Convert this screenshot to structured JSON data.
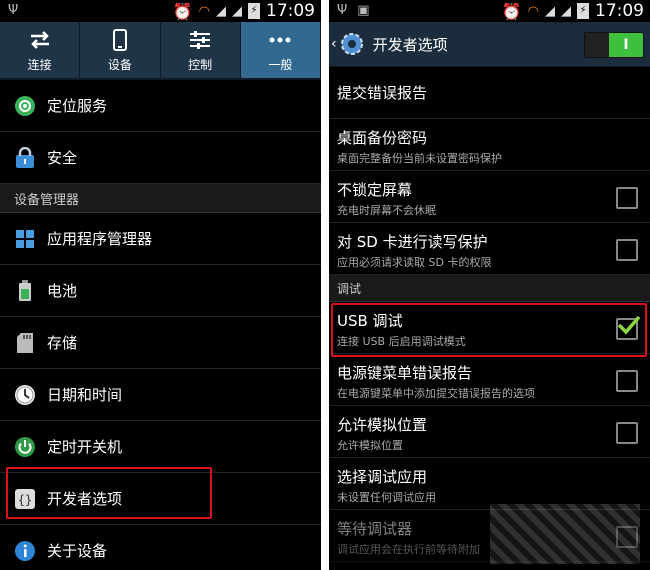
{
  "left": {
    "status": {
      "time": "17:09"
    },
    "tabs": [
      {
        "label": "连接",
        "icon": "swap-arrows-icon"
      },
      {
        "label": "设备",
        "icon": "phone-icon"
      },
      {
        "label": "控制",
        "icon": "sliders-icon"
      },
      {
        "label": "一般",
        "icon": "more-dots-icon",
        "active": true
      }
    ],
    "items_top": [
      {
        "label": "定位服务",
        "icon": "location-icon"
      },
      {
        "label": "安全",
        "icon": "lock-icon"
      }
    ],
    "section": "设备管理器",
    "items": [
      {
        "label": "应用程序管理器",
        "icon": "apps-grid-icon"
      },
      {
        "label": "电池",
        "icon": "battery-icon"
      },
      {
        "label": "存储",
        "icon": "sd-card-icon"
      },
      {
        "label": "日期和时间",
        "icon": "clock-icon"
      },
      {
        "label": "定时开关机",
        "icon": "power-icon"
      },
      {
        "label": "开发者选项",
        "icon": "braces-icon"
      },
      {
        "label": "关于设备",
        "icon": "info-icon"
      }
    ]
  },
  "right": {
    "status": {
      "time": "17:09"
    },
    "header": {
      "title": "开发者选项",
      "toggle_label": "I"
    },
    "options": [
      {
        "title": "提交错误报告",
        "subtitle": "",
        "checkbox": false
      },
      {
        "title": "桌面备份密码",
        "subtitle": "桌面完整备份当前未设置密码保护",
        "checkbox": false
      },
      {
        "title": "不锁定屏幕",
        "subtitle": "充电时屏幕不会休眠",
        "checkbox": true,
        "checked": false
      },
      {
        "title": "对 SD 卡进行读写保护",
        "subtitle": "应用必须请求读取 SD 卡的权限",
        "checkbox": true,
        "checked": false
      }
    ],
    "section": "调试",
    "debug_options": [
      {
        "title": "USB 调试",
        "subtitle": "连接 USB 后启用调试模式",
        "checkbox": true,
        "checked": true
      },
      {
        "title": "电源键菜单错误报告",
        "subtitle": "在电源键菜单中添加提交错误报告的选项",
        "checkbox": true,
        "checked": false
      },
      {
        "title": "允许模拟位置",
        "subtitle": "允许模拟位置",
        "checkbox": true,
        "checked": false
      },
      {
        "title": "选择调试应用",
        "subtitle": "未设置任何调试应用",
        "checkbox": false
      },
      {
        "title": "等待调试器",
        "subtitle": "调试应用会在执行前等待附加",
        "checkbox": true,
        "checked": false,
        "dimmed": true
      }
    ]
  },
  "colors": {
    "highlight": "#d8111a",
    "tab_active": "#33698f",
    "toggle_on": "#3fbf3f",
    "check": "#8cd63a"
  }
}
